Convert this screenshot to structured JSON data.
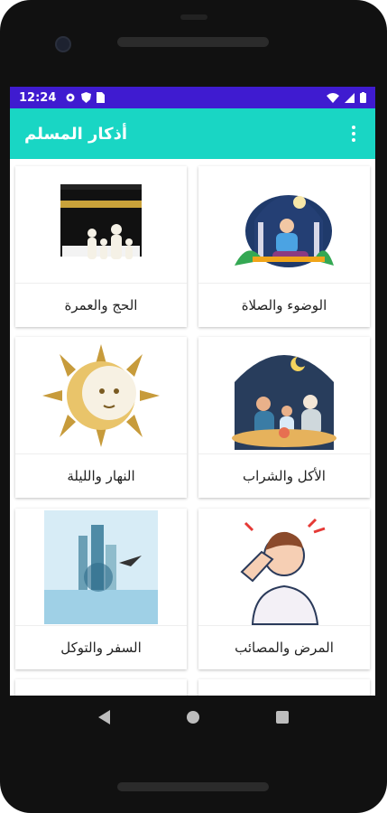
{
  "status": {
    "time": "12:24",
    "left_icons": [
      "settings-icon",
      "shield-icon",
      "sim-card-icon"
    ],
    "right_icons": [
      "wifi-icon",
      "signal-icon",
      "battery-icon"
    ]
  },
  "appbar": {
    "title": "أذكار المسلم",
    "menu_icon": "more-vert-icon"
  },
  "colors": {
    "status_bar": "#3f1bd0",
    "app_bar": "#19d6c4",
    "screen_bg": "#ffffff"
  },
  "categories": [
    {
      "label": "الوضوء والصلاة",
      "icon": "mosque-prayer-icon"
    },
    {
      "label": "الحج والعمرة",
      "icon": "kaaba-icon"
    },
    {
      "label": "الأكل والشراب",
      "icon": "family-eating-icon"
    },
    {
      "label": "النهار والليلة",
      "icon": "sun-moon-icon"
    },
    {
      "label": "المرض والمصائب",
      "icon": "sick-person-icon"
    },
    {
      "label": "السفر والتوكل",
      "icon": "travel-city-icon"
    }
  ]
}
